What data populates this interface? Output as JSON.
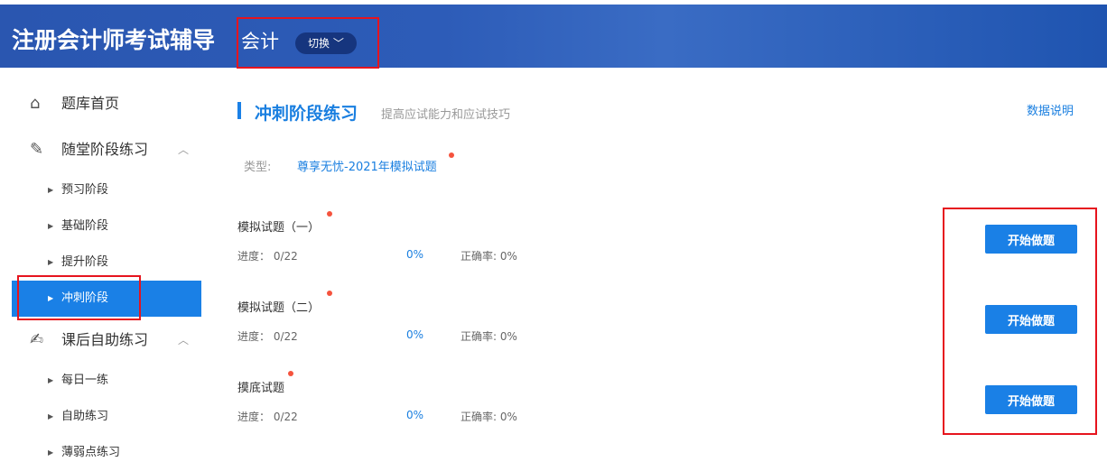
{
  "header": {
    "title": "注册会计师考试辅导",
    "subject": "会计",
    "switch_label": "切换"
  },
  "sidebar": {
    "home": "题库首页",
    "group1": {
      "label": "随堂阶段练习",
      "items": [
        "预习阶段",
        "基础阶段",
        "提升阶段",
        "冲刺阶段"
      ]
    },
    "group2": {
      "label": "课后自助练习",
      "items": [
        "每日一练",
        "自助练习",
        "薄弱点练习"
      ]
    }
  },
  "main": {
    "title": "冲刺阶段练习",
    "desc": "提高应试能力和应试技巧",
    "data_link": "数据说明",
    "type_label": "类型:",
    "type_value": "尊享无忧-2021年模拟试题",
    "exams": [
      {
        "name": "模拟试题（一）",
        "progress": "进度： 0/22",
        "percent": "0%",
        "accuracy": "正确率: 0%",
        "button": "开始做题"
      },
      {
        "name": "模拟试题（二）",
        "progress": "进度： 0/22",
        "percent": "0%",
        "accuracy": "正确率: 0%",
        "button": "开始做题"
      },
      {
        "name": "摸底试题",
        "progress": "进度： 0/22",
        "percent": "0%",
        "accuracy": "正确率: 0%",
        "button": "开始做题"
      }
    ]
  }
}
